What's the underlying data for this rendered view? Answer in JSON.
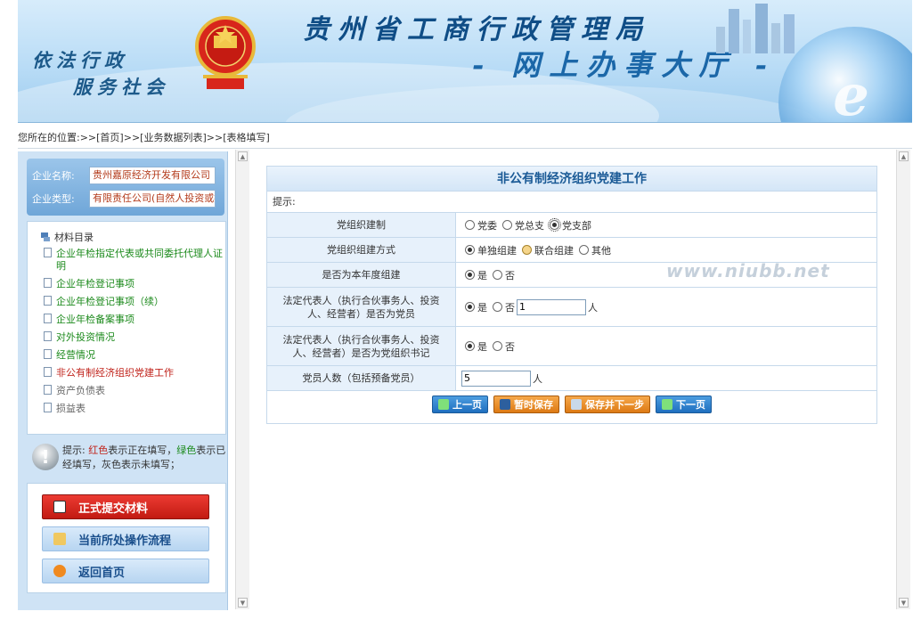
{
  "banner": {
    "slogan_line1": "依法行政",
    "slogan_line2": "服务社会",
    "agency_title": "贵州省工商行政管理局",
    "agency_subtitle": "- 网上办事大厅 -",
    "emblem_text": "工商行政管理"
  },
  "breadcrumb": {
    "prefix": "您所在的位置:>> ",
    "items": [
      "[首页]",
      " >>[业务数据列表]",
      " >>[表格填写]"
    ]
  },
  "company": {
    "name_label": "企业名称:",
    "name_value": "贵州嘉原经济开发有限公司",
    "type_label": "企业类型:",
    "type_value": "有限责任公司(自然人投资或控股)"
  },
  "tree": {
    "root": "材料目录",
    "items": [
      {
        "label": "企业年检指定代表或共同委托代理人证明",
        "status": "green"
      },
      {
        "label": "企业年检登记事项",
        "status": "green"
      },
      {
        "label": "企业年检登记事项（续）",
        "status": "green"
      },
      {
        "label": "企业年检备案事项",
        "status": "green"
      },
      {
        "label": "对外投资情况",
        "status": "green"
      },
      {
        "label": "经营情况",
        "status": "green"
      },
      {
        "label": "非公有制经济组织党建工作",
        "status": "red"
      },
      {
        "label": "资产负债表",
        "status": "gray"
      },
      {
        "label": "损益表",
        "status": "gray"
      }
    ]
  },
  "tip": {
    "prefix": "提示: ",
    "red_word": "红色",
    "mid1": "表示正在填写，",
    "green_word": "绿色",
    "mid2": "表示已经填写，灰色表示未填写；"
  },
  "actions": {
    "submit": "正式提交材料",
    "flow": "当前所处操作流程",
    "home": "返回首页"
  },
  "form": {
    "title": "非公有制经济组织党建工作",
    "hint_label": "提示:",
    "rows": [
      {
        "label": "党组织建制",
        "options": [
          "党委",
          "党总支",
          "党支部"
        ],
        "selected": "党支部"
      },
      {
        "label": "党组织组建方式",
        "options": [
          "单独组建",
          "联合组建",
          "其他"
        ],
        "selected": "单独组建"
      },
      {
        "label": "是否为本年度组建",
        "options": [
          "是",
          "否"
        ],
        "selected": "是"
      },
      {
        "label": "法定代表人（执行合伙事务人、投资人、经营者）是否为党员",
        "options": [
          "是",
          "否"
        ],
        "selected": "是",
        "input_value": "1",
        "unit": "人"
      },
      {
        "label": "法定代表人（执行合伙事务人、投资人、经营者）是否为党组织书记",
        "options": [
          "是",
          "否"
        ],
        "selected": "是"
      },
      {
        "label": "党员人数（包括预备党员）",
        "input_value": "5",
        "unit": "人"
      }
    ],
    "buttons": {
      "prev": "上一页",
      "save": "暂时保存",
      "save_next": "保存并下一步",
      "next": "下一页"
    }
  },
  "watermark": "www.niubb.net",
  "colors": {
    "accent": "#1a5a96",
    "in_progress": "#c0231b",
    "completed": "#1c8a1c",
    "not_filled": "#666666"
  }
}
